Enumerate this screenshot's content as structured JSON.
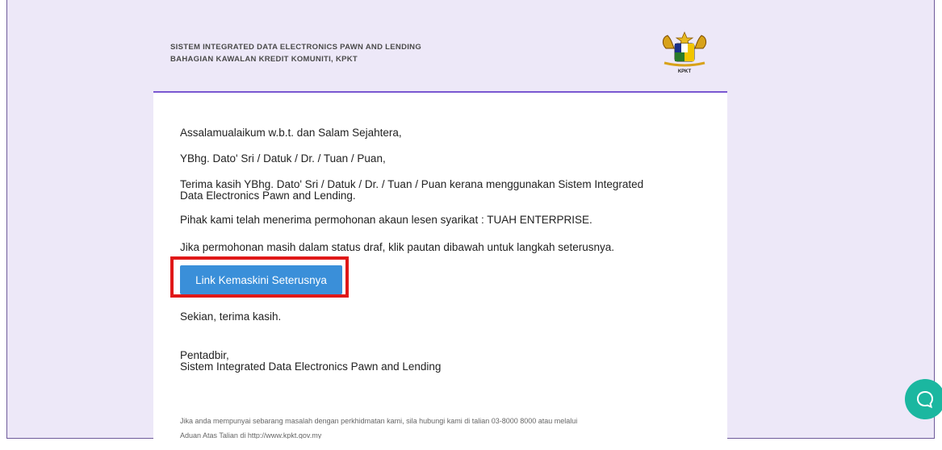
{
  "header": {
    "line1": "SISTEM INTEGRATED DATA ELECTRONICS PAWN AND LENDING",
    "line2": "BAHAGIAN KAWALAN KREDIT KOMUNITI, KPKT",
    "logo_text": "KPKT"
  },
  "email": {
    "greeting": "Assalamualaikum w.b.t. dan Salam Sejahtera,",
    "salutation": "YBhg. Dato' Sri / Datuk / Dr. / Tuan / Puan,",
    "para1_line1": "Terima kasih YBhg. Dato' Sri / Datuk / Dr. / Tuan / Puan kerana menggunakan Sistem Integrated",
    "para1_line2": "Data Electronics Pawn and Lending.",
    "para2": "Pihak kami telah menerima permohonan akaun lesen syarikat : TUAH ENTERPRISE.",
    "para3": "Jika permohonan masih dalam status draf, klik pautan dibawah untuk langkah seterusnya.",
    "button_label": "Link Kemaskini Seterusnya",
    "closing": "Sekian, terima kasih.",
    "signature_line1": "Pentadbir,",
    "signature_line2": "Sistem Integrated Data Electronics Pawn and Lending",
    "footer_line1": "Jika anda mempunyai sebarang masalah dengan perkhidmatan kami, sila hubungi kami di talian 03-8000 8000 atau melalui",
    "footer_line2": "Aduan Atas Talian di http://www.kpkt.gov.my"
  },
  "colors": {
    "accent": "#7a57d1",
    "button": "#3a8fd9",
    "highlight": "#e01818",
    "chat": "#1bb7a0"
  },
  "icons": {
    "logo": "coat-of-arms-icon",
    "chat": "chat-bubble-icon"
  }
}
